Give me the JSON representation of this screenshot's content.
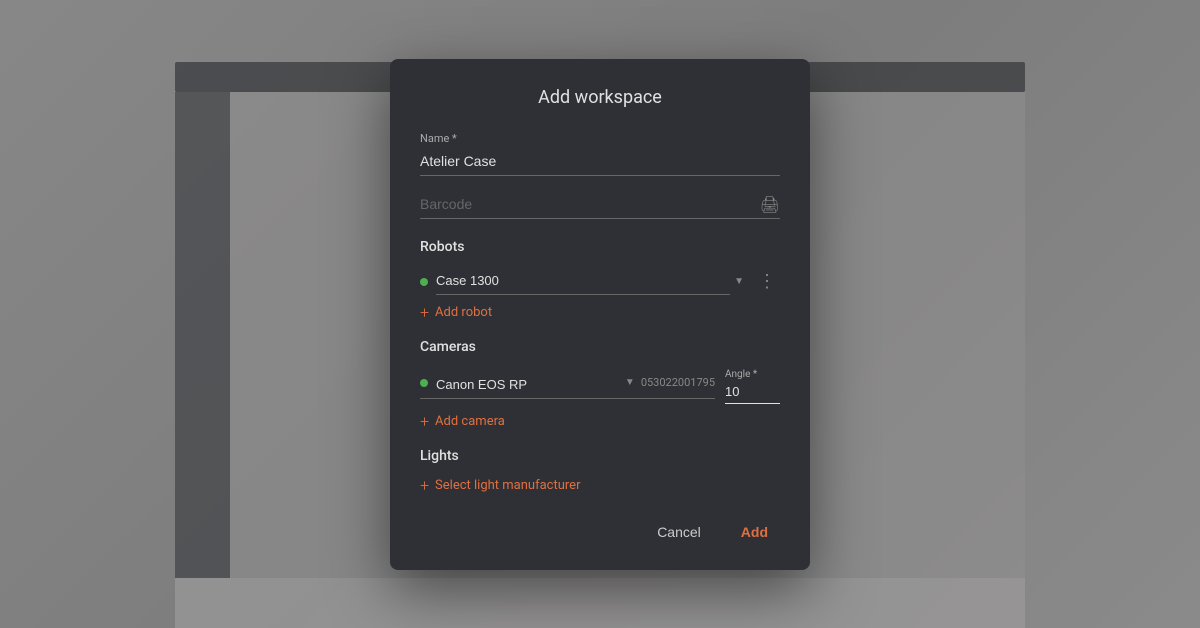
{
  "modal": {
    "title": "Add workspace",
    "name_label": "Name *",
    "name_value": "Atelier Case",
    "barcode_placeholder": "Barcode",
    "barcode_icon": "🖨",
    "sections": {
      "robots": {
        "label": "Robots",
        "items": [
          {
            "name": "Case 1300",
            "status": "green"
          }
        ],
        "add_label": "Add robot"
      },
      "cameras": {
        "label": "Cameras",
        "items": [
          {
            "name": "Canon EOS RP",
            "serial": "053022001795",
            "status": "green",
            "angle_label": "Angle *",
            "angle_value": "10"
          }
        ],
        "add_label": "Add camera"
      },
      "lights": {
        "label": "Lights",
        "add_label": "Select light manufacturer"
      }
    },
    "footer": {
      "cancel_label": "Cancel",
      "add_label": "Add"
    }
  }
}
